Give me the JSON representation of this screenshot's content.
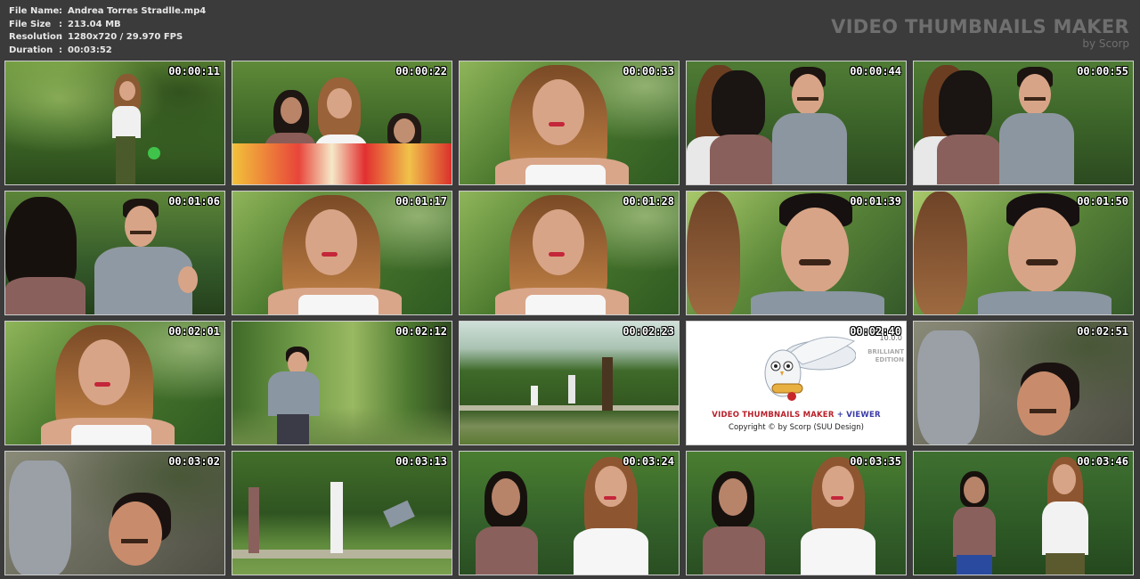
{
  "file_info": [
    {
      "label": "File Name",
      "value": "Andrea Torres Stradlle.mp4"
    },
    {
      "label": "File Size",
      "value": "213.04 MB"
    },
    {
      "label": "Resolution",
      "value": "1280x720 / 29.970 FPS"
    },
    {
      "label": "Duration",
      "value": "00:03:52"
    }
  ],
  "separator": ":",
  "brand": {
    "title": "VIDEO THUMBNAILS MAKER",
    "subtitle": "by Scorp"
  },
  "thumbnails": [
    {
      "time": "00:00:11",
      "scene": "woman-park"
    },
    {
      "time": "00:00:22",
      "scene": "group-park"
    },
    {
      "time": "00:00:33",
      "scene": "woman-closeup"
    },
    {
      "time": "00:00:44",
      "scene": "man-women"
    },
    {
      "time": "00:00:55",
      "scene": "man-women"
    },
    {
      "time": "00:01:06",
      "scene": "man-gesture"
    },
    {
      "time": "00:01:17",
      "scene": "woman-closeup"
    },
    {
      "time": "00:01:28",
      "scene": "woman-closeup"
    },
    {
      "time": "00:01:39",
      "scene": "man-closeup"
    },
    {
      "time": "00:01:50",
      "scene": "man-closeup"
    },
    {
      "time": "00:02:01",
      "scene": "woman-closeup"
    },
    {
      "time": "00:02:12",
      "scene": "man-running"
    },
    {
      "time": "00:02:23",
      "scene": "park-wide"
    },
    {
      "time": "00:02:40",
      "scene": "logo"
    },
    {
      "time": "00:02:51",
      "scene": "man-ground"
    },
    {
      "time": "00:03:02",
      "scene": "man-ground"
    },
    {
      "time": "00:03:13",
      "scene": "park-wide-people"
    },
    {
      "time": "00:03:24",
      "scene": "two-women"
    },
    {
      "time": "00:03:35",
      "scene": "two-women"
    },
    {
      "time": "00:03:46",
      "scene": "two-women-wide"
    }
  ],
  "logo": {
    "title_red": "VIDEO THUMBNAILS MAKER",
    "title_plus": " + ",
    "title_blue": "VIEWER",
    "copyright": "Copyright © by Scorp (SUU Design)",
    "version": "10.0.0",
    "edition_line1": "BRILLIANT",
    "edition_line2": "EDITION"
  }
}
